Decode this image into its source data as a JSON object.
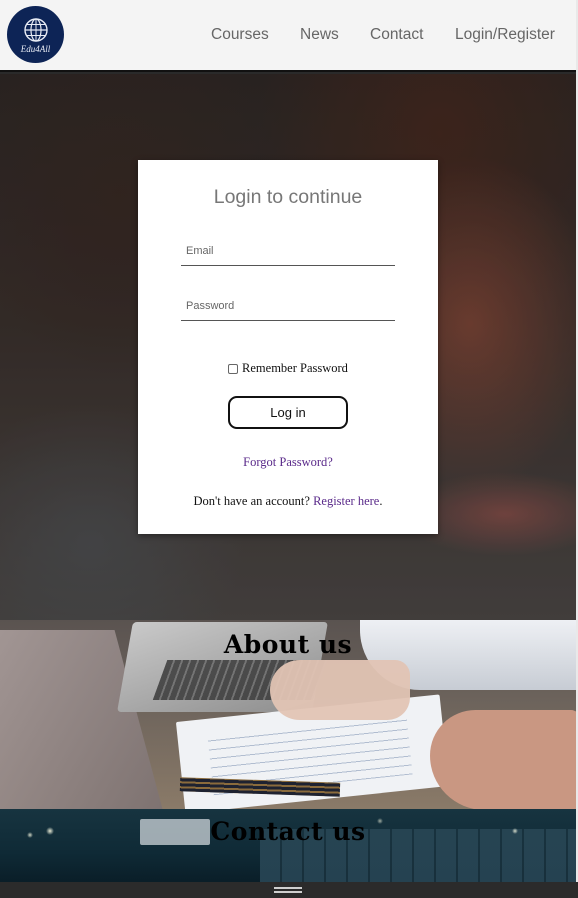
{
  "brand": {
    "logo_text": "Edu4All",
    "logo_icon": "globe-icon",
    "logo_color": "#0d2456"
  },
  "nav": {
    "items": [
      {
        "label": "Courses"
      },
      {
        "label": "News"
      },
      {
        "label": "Contact"
      },
      {
        "label": "Login/Register"
      }
    ]
  },
  "login": {
    "title": "Login to continue",
    "email_placeholder": "Email",
    "password_placeholder": "Password",
    "remember_label": "Remember Password",
    "remember_checked": false,
    "login_button": "Log in",
    "forgot_link": "Forgot Password?",
    "register_prompt": "Don't have an account?",
    "register_link": "Register here",
    "register_suffix": "."
  },
  "sections": {
    "about_title": "About us",
    "contact_title": "Contact us"
  },
  "colors": {
    "link": "#5a2a8a",
    "header_bg": "#f4f4f4",
    "nav_text": "#666666"
  }
}
